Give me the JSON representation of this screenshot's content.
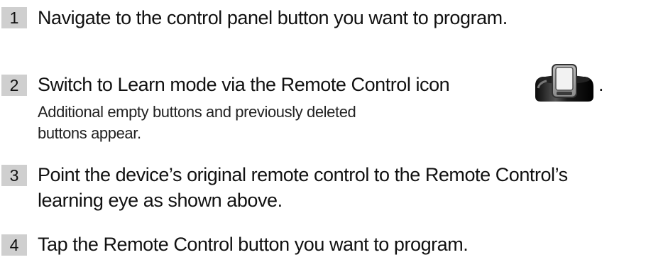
{
  "steps": [
    {
      "number": "1",
      "text": "Navigate to the control panel button you want to program."
    },
    {
      "number": "2",
      "text": "Switch to Learn mode via the Remote Control icon",
      "icon": "remote-control-icon",
      "trailing": ".",
      "note_lines": [
        "Additional empty buttons and previously deleted",
        "buttons appear."
      ]
    },
    {
      "number": "3",
      "text_lines": [
        "Point the device’s original remote control to the Remote Control’s",
        "learning eye as shown above."
      ]
    },
    {
      "number": "4",
      "text": "Tap the Remote Control button you want to program."
    }
  ]
}
